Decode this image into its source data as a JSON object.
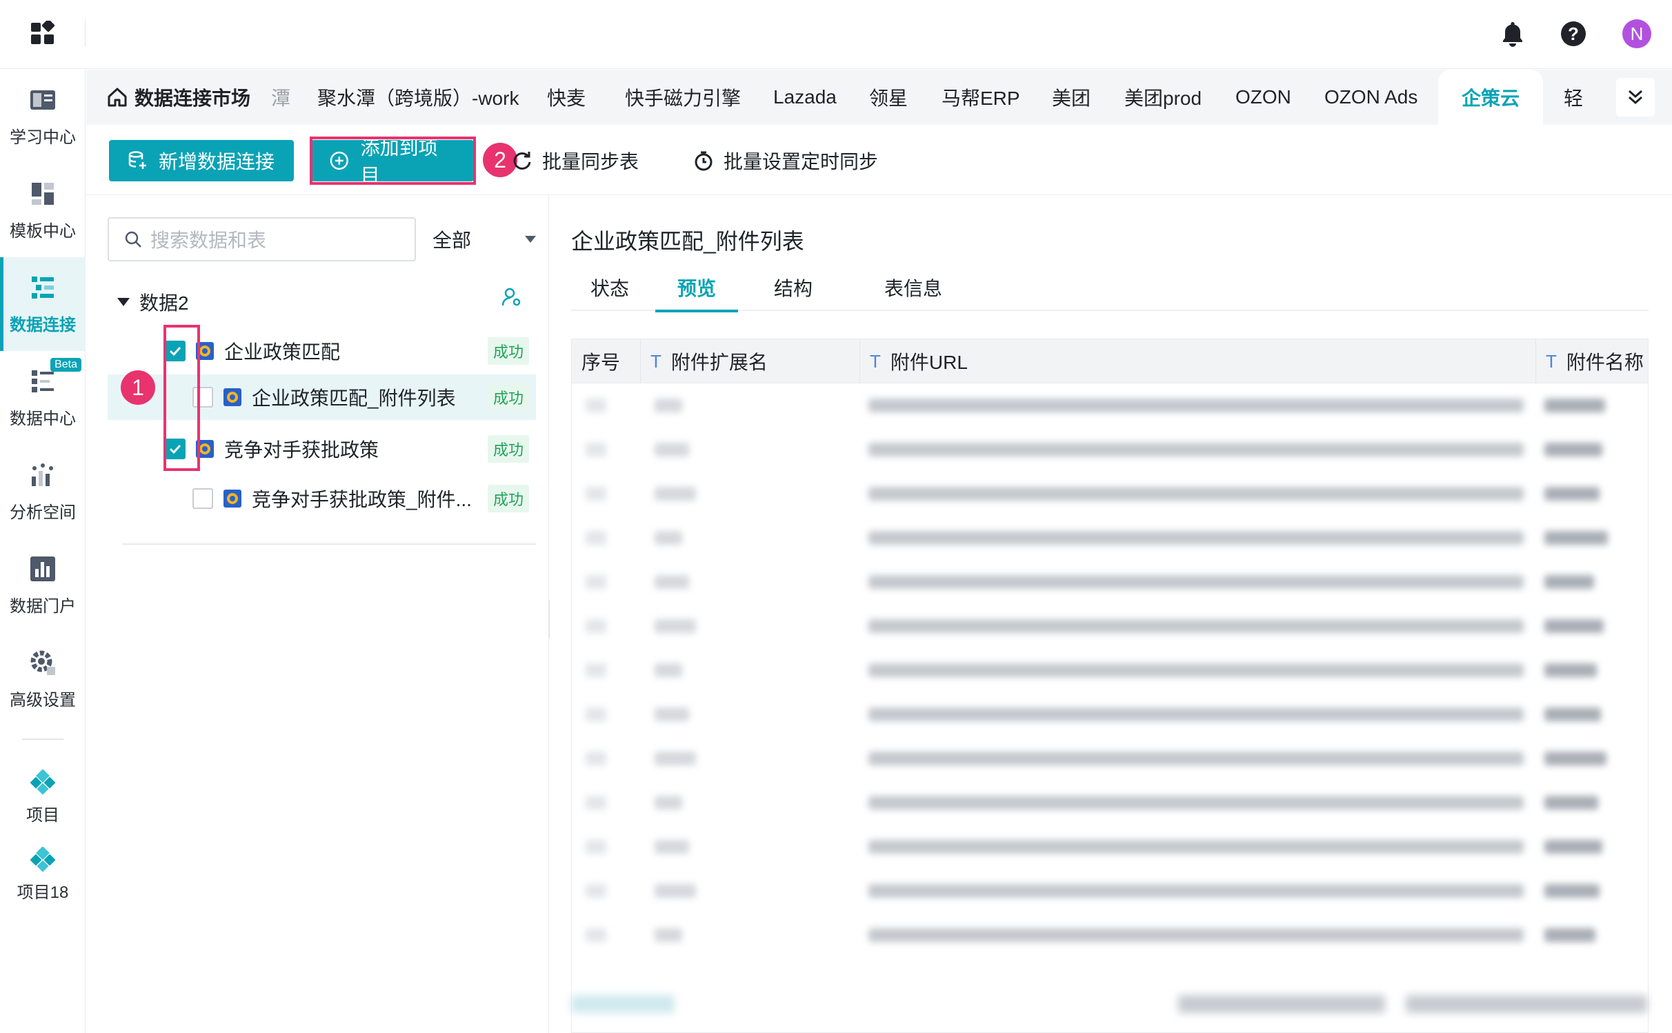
{
  "topbar": {
    "avatar_letter": "N"
  },
  "leftnav": {
    "items": [
      {
        "label": "学习中心",
        "icon": "learning-center-icon"
      },
      {
        "label": "模板中心",
        "icon": "template-icon"
      },
      {
        "label": "数据连接",
        "icon": "data-connection-icon",
        "active": true
      },
      {
        "label": "数据中心",
        "icon": "data-center-icon",
        "badge": "Beta"
      },
      {
        "label": "分析空间",
        "icon": "analysis-icon"
      },
      {
        "label": "数据门户",
        "icon": "portal-icon"
      },
      {
        "label": "高级设置",
        "icon": "gear-icon"
      }
    ],
    "projects": [
      {
        "label": "项目"
      },
      {
        "label": "项目18"
      }
    ]
  },
  "tabs": {
    "home": "数据连接市场",
    "truncated": "潭",
    "items": [
      "聚水潭（跨境版）-work",
      "快麦",
      "快手磁力引擎",
      "Lazada",
      "领星",
      "马帮ERP",
      "美团",
      "美团prod",
      "OZON",
      "OZON Ads",
      "企策云",
      "轻"
    ],
    "active": "企策云"
  },
  "toolbar": {
    "new_connection": "新增数据连接",
    "add_to_project": "添加到项目",
    "batch_sync": "批量同步表",
    "batch_schedule": "批量设置定时同步",
    "step_1": "1",
    "step_2": "2"
  },
  "left_panel": {
    "search_placeholder": "搜索数据和表",
    "filter": "全部",
    "group": "数据2",
    "rows": [
      {
        "label": "企业政策匹配",
        "status": "成功",
        "checked": true
      },
      {
        "label": "企业政策匹配_附件列表",
        "status": "成功",
        "checked": false
      },
      {
        "label": "竞争对手获批政策",
        "status": "成功",
        "checked": true
      },
      {
        "label": "竞争对手获批政策_附件...",
        "status": "成功",
        "checked": false
      }
    ]
  },
  "right_panel": {
    "title": "企业政策匹配_附件列表",
    "tabs": [
      "状态",
      "预览",
      "结构",
      "表信息"
    ],
    "active_tab": "预览",
    "columns": [
      {
        "name": "序号",
        "type": ""
      },
      {
        "name": "附件扩展名",
        "type": "T"
      },
      {
        "name": "附件URL",
        "type": "T"
      },
      {
        "name": "附件名称",
        "type": "T"
      }
    ]
  },
  "colors": {
    "accent": "#0aa3b5",
    "highlight": "#e8336f",
    "success": "#1fa55a"
  }
}
